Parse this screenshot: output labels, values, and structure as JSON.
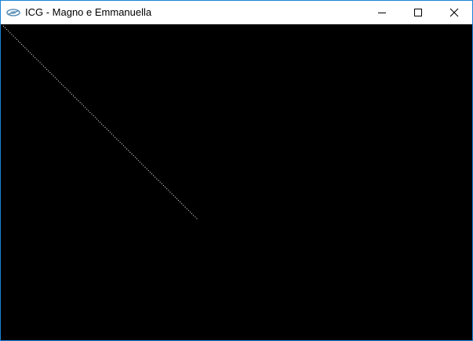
{
  "window": {
    "title": "ICG - Magno e Emmanuella",
    "icon": "opengl-app-icon",
    "controls": [
      "minimize-icon",
      "maximize-icon",
      "close-icon"
    ]
  },
  "canvas": {
    "background": "#000000",
    "line_color": "#ffffff",
    "line_style": "dotted"
  }
}
